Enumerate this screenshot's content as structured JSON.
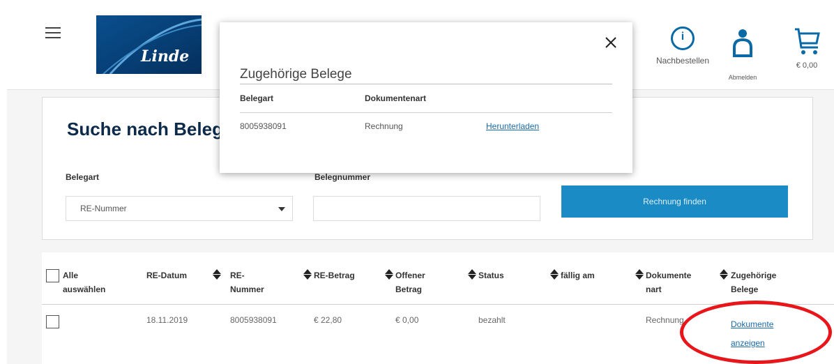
{
  "header": {
    "logo_text": "Linde",
    "reorder_label": "Nachbestellen",
    "logout_label": "Abmelden",
    "cart_amount": "€ 0,00",
    "colors": {
      "accent": "#1a8bc4",
      "logo_bg": "#0a4f8e",
      "link": "#1a6aa8",
      "highlight": "#e8161a"
    }
  },
  "search": {
    "title": "Suche nach Belege",
    "belegart_label": "Belegart",
    "belegnummer_label": "Belegnummer",
    "belegart_selected": "RE-Nummer",
    "belegnummer_value": "",
    "find_button": "Rechnung finden"
  },
  "table": {
    "select_all_line1": "Alle",
    "select_all_line2": "auswählen",
    "columns": {
      "re_datum": "RE-Datum",
      "re_nummer_1": "RE-",
      "re_nummer_2": "Nummer",
      "re_betrag": "RE-Betrag",
      "offener_1": "Offener",
      "offener_2": "Betrag",
      "status": "Status",
      "faellig": "fällig am",
      "dokumente_1": "Dokumente",
      "dokumente_2": "nart",
      "zugehoerige_1": "Zugehörige",
      "zugehoerige_2": "Belege"
    },
    "rows": [
      {
        "re_datum": "18.11.2019",
        "re_nummer": "8005938091",
        "re_betrag": "€ 22,80",
        "offener_betrag": "€ 0,00",
        "status": "bezahlt",
        "faellig_am": "",
        "dokumentenart": "Rechnung",
        "link_line1": "Dokumente",
        "link_line2": "anzeigen"
      }
    ]
  },
  "modal": {
    "title": "Zugehörige Belege",
    "col_belegart": "Belegart",
    "col_dokumentenart": "Dokumentenart",
    "rows": [
      {
        "belegart": "8005938091",
        "dokumentenart": "Rechnung",
        "link": "Herunterladen"
      }
    ]
  }
}
